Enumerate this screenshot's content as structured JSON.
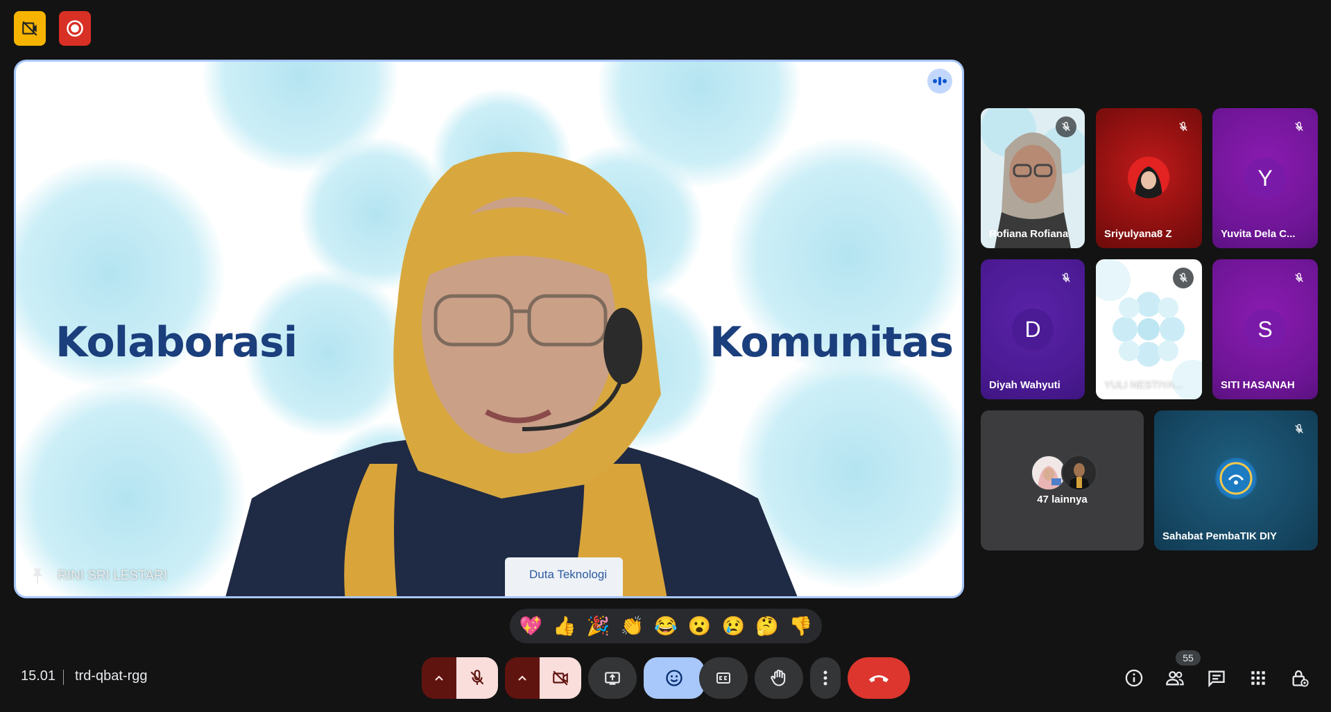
{
  "main": {
    "word_left": "Kolaborasi",
    "word_right": "Komunitas",
    "speaker_name": "RINI SRI LESTARI",
    "vest_text": "Duta Teknologi"
  },
  "participants": [
    {
      "name": "Rofiana Rofiana"
    },
    {
      "name": "Sriyulyana8 Z"
    },
    {
      "name": "Yuvita Dela C...",
      "initial": "Y"
    },
    {
      "name": "Diyah Wahyuti",
      "initial": "D"
    },
    {
      "name": "YULI NESTIYA..."
    },
    {
      "name": "SITI HASANAH",
      "initial": "S"
    },
    {
      "name": "47 lainnya"
    },
    {
      "name": "Sahabat PembaTIK DIY"
    }
  ],
  "reactions": [
    "💖",
    "👍",
    "🎉",
    "👏",
    "😂",
    "😮",
    "😢",
    "🤔",
    "👎"
  ],
  "meeting": {
    "time": "15.01",
    "code": "trd-qbat-rgg",
    "people_count": "55"
  },
  "colors": {
    "background": "#131313",
    "active_border": "#a8c7fa",
    "end_call": "#dc362e",
    "muted_pill": "#f9dedc",
    "tile_purple": "#6a0dad",
    "tile_red": "#b31b1b"
  },
  "icons": {
    "top_left_1": "no-recording-icon",
    "top_left_2": "record-icon",
    "controls": [
      "mic-off-icon",
      "camera-off-icon",
      "present-icon",
      "emoji-icon",
      "captions-icon",
      "raise-hand-icon",
      "more-icon",
      "end-call-icon"
    ],
    "right": [
      "info-icon",
      "people-icon",
      "chat-icon",
      "activities-icon",
      "host-controls-icon"
    ]
  }
}
